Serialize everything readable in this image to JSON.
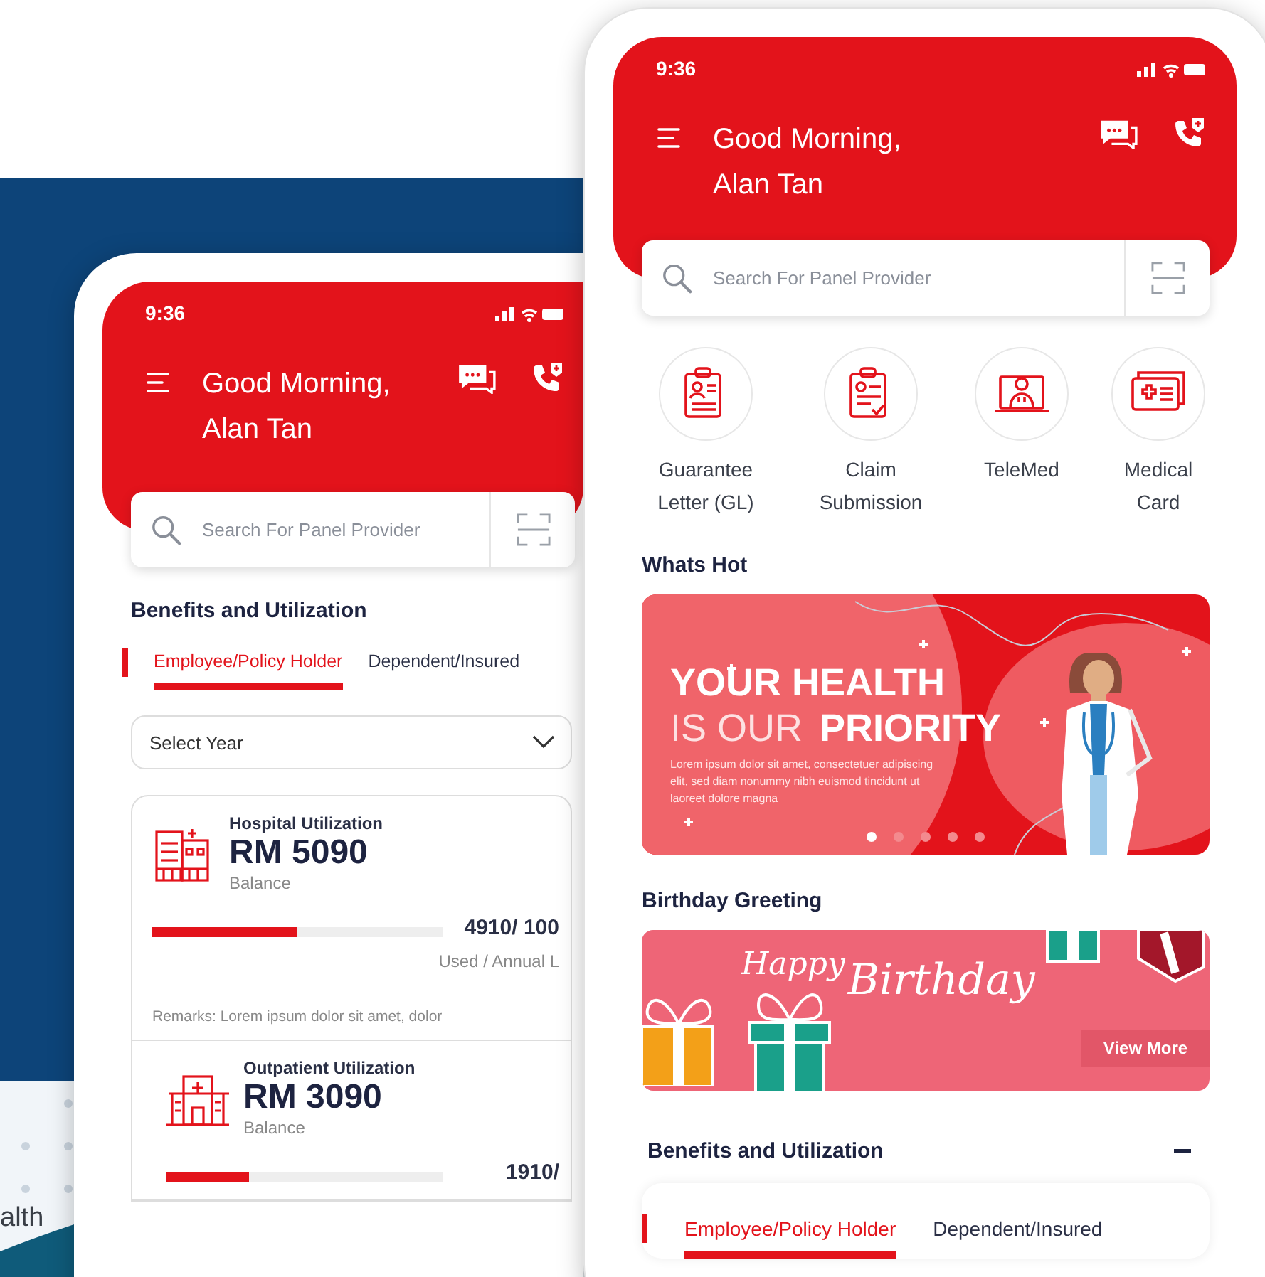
{
  "backdrop_text": "alth",
  "back_phone": {
    "status_time": "9:36",
    "greeting": [
      "Good Morning,",
      "Alan Tan"
    ],
    "search_placeholder": "Search For Panel Provider",
    "section_title": "Benefits and Utilization",
    "tabs": [
      {
        "label": "Employee/Policy Holder",
        "selected": true
      },
      {
        "label": "Dependent/Insured",
        "selected": false
      }
    ],
    "year_placeholder": "Select Year",
    "cards": [
      {
        "kind": "hospital",
        "title": "Hospital Utilization",
        "amount": "RM 5090",
        "amount_label": "Balance",
        "level": 0.5,
        "usage": "4910/ 100",
        "usage_label": "Used / Annual L",
        "remarks": "Remarks: Lorem ipsum dolor sit amet, dolor"
      },
      {
        "kind": "clinic",
        "title": "Outpatient Utilization",
        "amount": "RM 3090",
        "amount_label": "Balance",
        "level": 0.3,
        "usage": "1910/"
      }
    ]
  },
  "front_phone": {
    "status_time": "9:36",
    "greeting": [
      "Good Morning,",
      "Alan Tan"
    ],
    "search_placeholder": "Search For Panel Provider",
    "quick_actions": [
      {
        "kind": "guarantee",
        "label": "Guarantee Letter (GL)"
      },
      {
        "kind": "claim",
        "label": "Claim Submission"
      },
      {
        "kind": "telemed",
        "label": "TeleMed"
      },
      {
        "kind": "card",
        "label": "Medical Card"
      }
    ],
    "whats_hot_title": "Whats Hot",
    "hot_banner": {
      "headline_top": "YOUR HEALTH",
      "headline_light": "IS OUR",
      "headline_bold": "PRIORITY",
      "body": "Lorem ipsum dolor sit amet, consectetuer adipiscing elit, sed diam nonummy nibh euismod tincidunt ut laoreet dolore magna",
      "dots": [
        {
          "selected": true
        },
        {
          "selected": false
        },
        {
          "selected": false
        },
        {
          "selected": false
        },
        {
          "selected": false
        }
      ]
    },
    "birthday_title": "Birthday Greeting",
    "birthday_banner": {
      "script_small": "Happy",
      "script_large": "Birthday",
      "button": "View More"
    },
    "benefits_title": "Benefits and Utilization",
    "tabs": [
      {
        "label": "Employee/Policy Holder",
        "selected": true
      },
      {
        "label": "Dependent/Insured",
        "selected": false
      }
    ]
  }
}
